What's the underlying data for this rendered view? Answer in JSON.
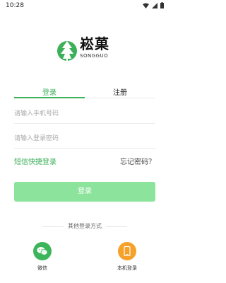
{
  "status": {
    "time": "10:28"
  },
  "logo": {
    "brand_cn": "崧菓",
    "brand_en": "SONGGUO"
  },
  "tabs": {
    "login": "登录",
    "register": "注册"
  },
  "form": {
    "phone_placeholder": "请输入手机号码",
    "password_placeholder": "请输入登录密码",
    "sms_login": "短信快捷登录",
    "forgot_password": "忘记密码？",
    "login_button": "登录"
  },
  "other": {
    "title": "其他登录方式",
    "wechat_label": "微信",
    "local_label": "本机登录"
  },
  "colors": {
    "accent": "#3db05a",
    "login_button": "#8ce39c",
    "wechat": "#3db55a",
    "local": "#f6a12a"
  }
}
